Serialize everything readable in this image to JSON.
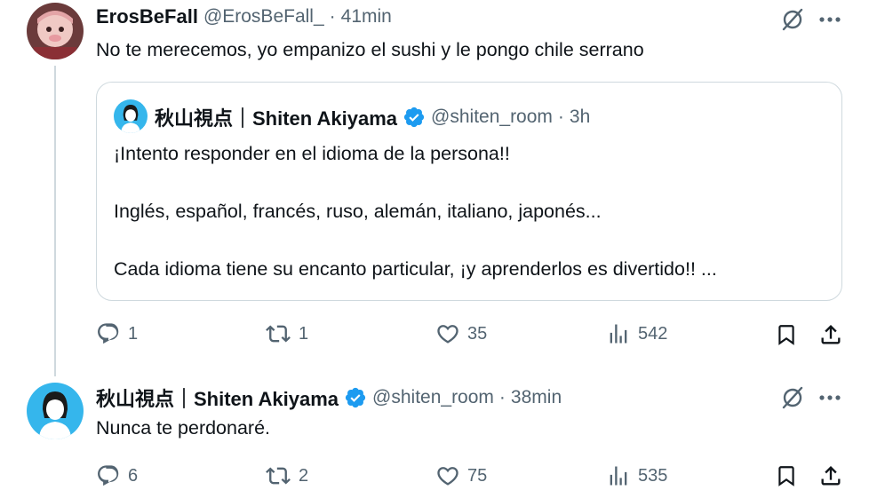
{
  "tweet1": {
    "display_name": "ErosBeFall",
    "handle": "@ErosBeFall_",
    "separator": "·",
    "time": "41min",
    "text": "No te merecemos, yo empanizo el sushi y le pongo chile serrano",
    "quote": {
      "display_name": "秋山視点｜Shiten Akiyama",
      "handle": "@shiten_room",
      "separator": "·",
      "time": "3h",
      "line1": "¡Intento responder en el idioma de la persona!!",
      "line2": "Inglés, español, francés, ruso, alemán, italiano, japonés...",
      "line3": "Cada idioma tiene su encanto particular, ¡y aprenderlos es divertido!! ..."
    },
    "actions": {
      "replies": "1",
      "reposts": "1",
      "likes": "35",
      "views": "542"
    }
  },
  "tweet2": {
    "display_name": "秋山視点｜Shiten Akiyama",
    "handle": "@shiten_room",
    "separator": "·",
    "time": "38min",
    "text": "Nunca te perdonaré.",
    "actions": {
      "replies": "6",
      "reposts": "2",
      "likes": "75",
      "views": "535"
    }
  },
  "colors": {
    "text": "#0f1419",
    "secondary": "#536471",
    "verified": "#1d9bf0",
    "border": "#cfd9de"
  },
  "icons": [
    "grok-icon",
    "more-icon",
    "reply-icon",
    "repost-icon",
    "like-icon",
    "views-icon",
    "bookmark-icon",
    "share-icon",
    "verified-badge-icon"
  ]
}
